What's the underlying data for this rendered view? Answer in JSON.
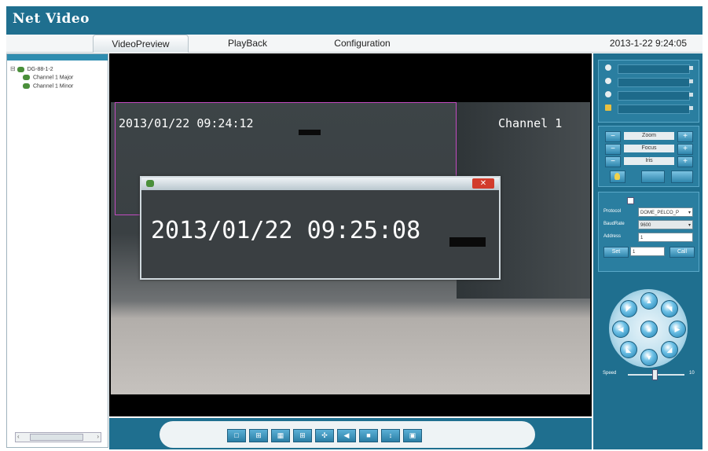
{
  "app": {
    "title": "Net Video"
  },
  "tabs": [
    {
      "label": "VideoPreview"
    },
    {
      "label": "PlayBack"
    },
    {
      "label": "Configuration"
    }
  ],
  "datetime": "2013-1-22  9:24:05",
  "tree": {
    "root": "DG-88-1-2",
    "children": [
      "Channel 1 Major",
      "Channel 1 Minor"
    ]
  },
  "video": {
    "osd_time": "2013/01/22 09:24:12",
    "channel": "Channel 1",
    "popup_time": "2013/01/22 09:25:08"
  },
  "ptz_controls": {
    "zoom_label": "Zoom",
    "focus_label": "Focus",
    "iris_label": "Iris",
    "minus": "−",
    "plus": "+"
  },
  "ptz_form": {
    "protocol_label": "Protocol",
    "protocol_value": "DOME_PELCO_P",
    "baudrate_label": "BaudRate",
    "baudrate_value": "9600",
    "address_label": "Address",
    "address_value": "1",
    "set_label": "Set",
    "set_value": "1",
    "call_label": "Call"
  },
  "speed": {
    "label": "Speed",
    "max": "10",
    "level_fraction": 0.48
  },
  "colors": {
    "header": "#1f6f8f",
    "panel": "#2a7ea0",
    "video_bg": "#000000"
  }
}
